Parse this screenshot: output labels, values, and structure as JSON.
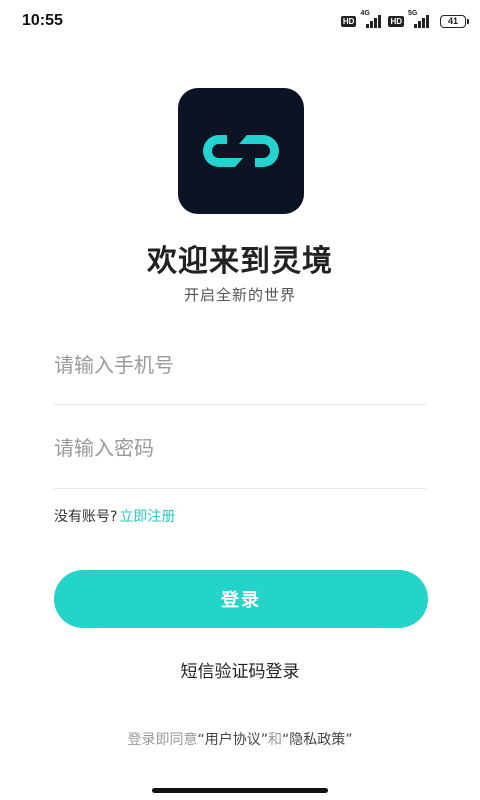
{
  "status_bar": {
    "time": "10:55",
    "hd_label": "HD",
    "network_1": "4G",
    "network_2": "5G",
    "battery": "41"
  },
  "app": {
    "logo_icon": "chain-link-logo-icon",
    "brand_color": "#25d4c9",
    "logo_bg_color": "#0c1424"
  },
  "welcome": {
    "title": "欢迎来到灵境",
    "subtitle": "开启全新的世界"
  },
  "form": {
    "phone_placeholder": "请输入手机号",
    "phone_value": "",
    "password_placeholder": "请输入密码",
    "password_value": ""
  },
  "register": {
    "prompt": "没有账号?",
    "link": "立即注册"
  },
  "login_button": "登录",
  "sms_login": "短信验证码登录",
  "agreement": {
    "prefix": "登录即同意",
    "user_agreement": "“用户协议”",
    "and": "和",
    "privacy_policy": "“隐私政策”"
  }
}
